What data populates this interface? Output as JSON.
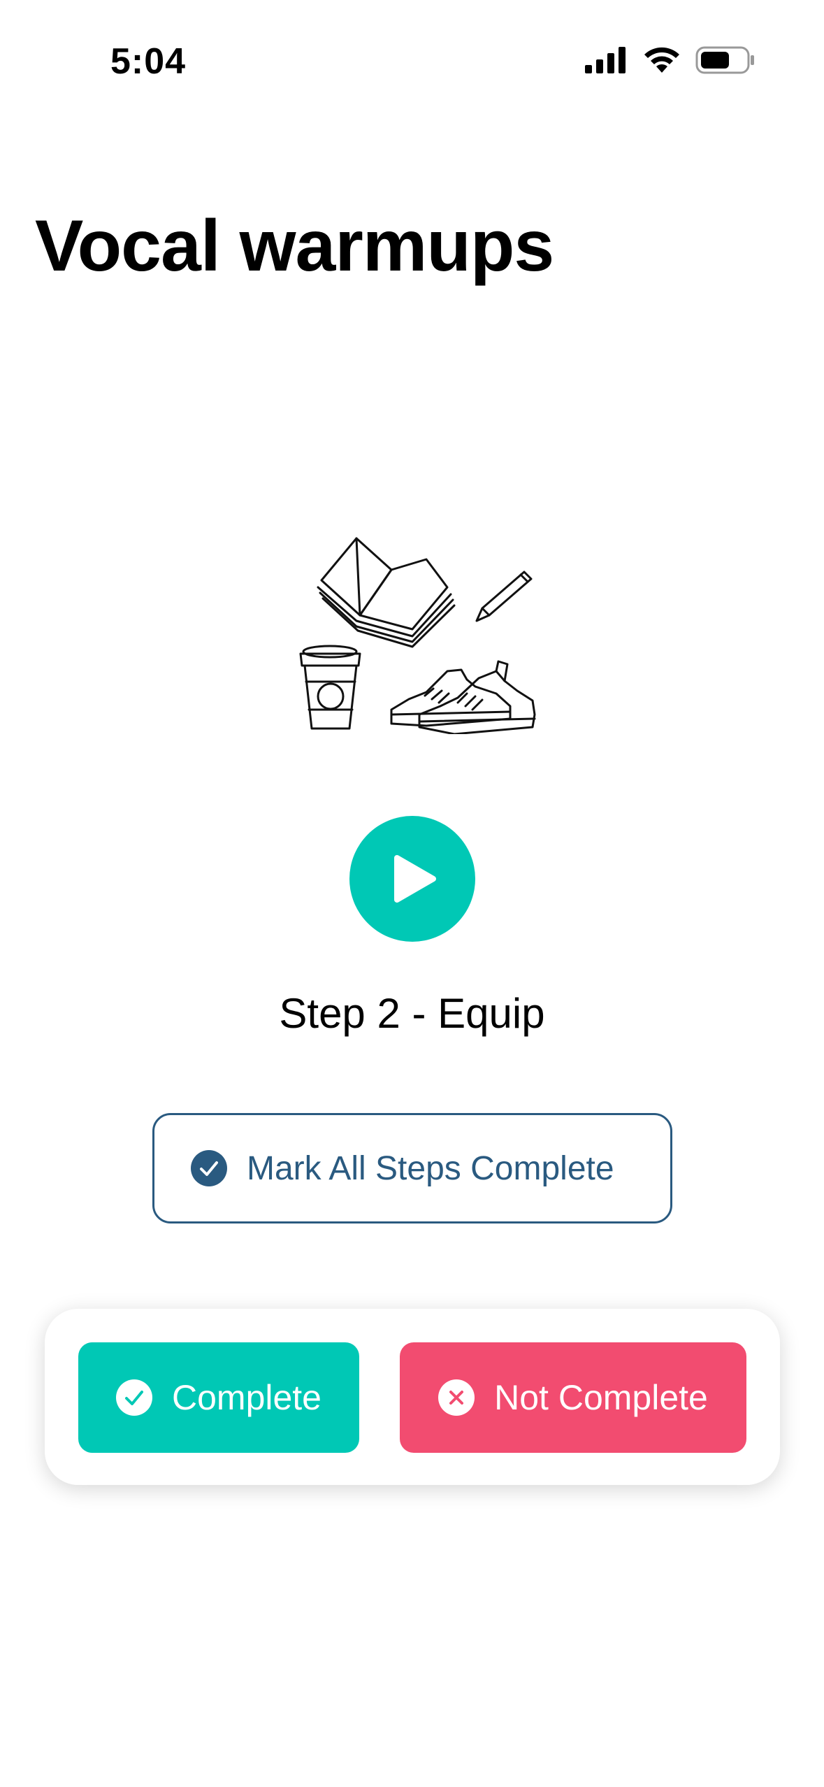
{
  "status_bar": {
    "time": "5:04",
    "icons": [
      "signal-icon",
      "wifi-icon",
      "battery-icon"
    ]
  },
  "page": {
    "title": "Vocal warmups"
  },
  "step": {
    "title": "Step 2 - Equip",
    "illustration_icon": "book-pencil-cup-sneakers-illustration"
  },
  "buttons": {
    "play_icon": "play-icon",
    "mark_all_label": "Mark All Steps Complete",
    "complete_label": "Complete",
    "not_complete_label": "Not Complete"
  },
  "colors": {
    "accent_teal": "#00c8b5",
    "danger_pink": "#f24c70",
    "navy": "#2a5a80"
  }
}
